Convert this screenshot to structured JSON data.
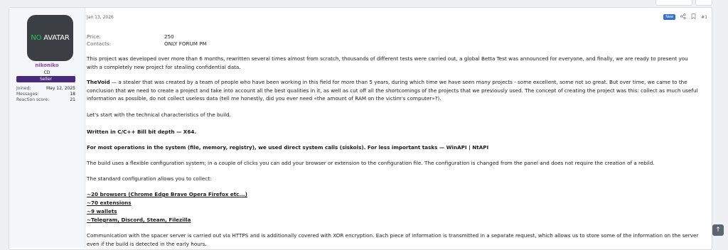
{
  "post": {
    "date": "Jan 13, 2026",
    "badge_new": "New",
    "post_number": "#1",
    "icons": {
      "share": "share-icon",
      "bookmark": "bookmark-icon"
    }
  },
  "author": {
    "avatar_text_a": "NO",
    "avatar_text_b": "AVATAR",
    "name": "nikoniko",
    "title": "CD",
    "banner": "Seller",
    "stats": [
      {
        "label": "Joined:",
        "value": "May 12, 2025"
      },
      {
        "label": "Messages:",
        "value": "18"
      },
      {
        "label": "Reaction score:",
        "value": "21"
      }
    ]
  },
  "details": [
    {
      "label": "Price:",
      "value": "250"
    },
    {
      "label": "Contacts:",
      "value": "ONLY FORUM PM"
    }
  ],
  "body": {
    "p1": "This project was developed over more than 6 months, rewritten several times almost from scratch, thousands of different tests were carried out, a global Betta Test was announced for everyone, and finally, we are ready to present you with a completely new project for stealing confidential data.",
    "p2_strong": "TheVoid",
    "p2": " — a stealer that was created by a team of people who have been working in this field for more than 5 years, during which time we have seen many projects - some excellent, some not so great. But over time, we came to the conclusion that we need to create a project and take into account all the best qualities in it, as well as cut off all the shortcomings of the projects that we previously used. The concept of creating the project was this: collect as much useful information as possible, do not collect useless data (tell me honestly, did you ever need «the amount of RAM on the victim's computer»?).",
    "p3": "Let's start with the technical characteristics of the build.",
    "p4": "Written in C/C++ Bill bit depth — X64.",
    "p5": "For most operations in the system (file, memory, registry), we used direct system calls (siskols). For less important tasks — WinAPI | NtAPI",
    "p6": "The build uses a flexible configuration system; in a couple of clicks you can add your browser or extension to the configuration file. The configuration is changed from the panel and does not require the creation of a rebild.",
    "p7": "The standard configuration allows you to collect:",
    "list": [
      "~20 browsers (Chrome Edge Brave Opera Firefox etc...)",
      "~70 extensions",
      "~9 wallets",
      "~Telegram, Discord, Steam, Filezilla"
    ],
    "p8": "Communication with the spacer server is carried out via HTTPS and is additionally covered with XOR encryption. Each piece of information is transmitted in a separate request, which allows us to store some of the information on the server even if the build is detected in the early hours."
  },
  "scroll_icon": "arrow-up-icon"
}
